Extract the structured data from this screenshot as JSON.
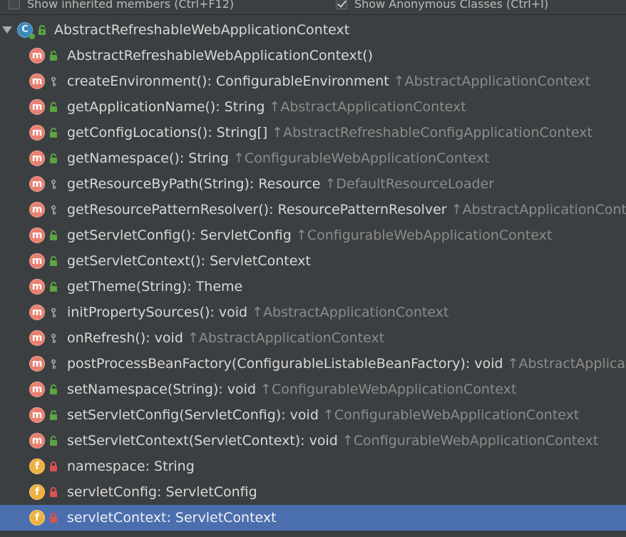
{
  "options": {
    "show_inherited_label": "Show inherited members (Ctrl+F12)",
    "show_inherited_checked": false,
    "show_anonymous_label": "Show Anonymous Classes (Ctrl+I)",
    "show_anonymous_checked": true
  },
  "root": {
    "name": "AbstractRefreshableWebApplicationContext",
    "icon": "abstract-class-icon",
    "visibility": "public",
    "expanded": true
  },
  "members": [
    {
      "kind": "m",
      "vis": "public",
      "name": "AbstractRefreshableWebApplicationContext()",
      "inherited": ""
    },
    {
      "kind": "m",
      "vis": "protected",
      "name": "createEnvironment(): ConfigurableEnvironment",
      "inherited": "↑AbstractApplicationContext"
    },
    {
      "kind": "m",
      "vis": "public",
      "name": "getApplicationName(): String",
      "inherited": "↑AbstractApplicationContext"
    },
    {
      "kind": "m",
      "vis": "public",
      "name": "getConfigLocations(): String[]",
      "inherited": "↑AbstractRefreshableConfigApplicationContext"
    },
    {
      "kind": "m",
      "vis": "public",
      "name": "getNamespace(): String",
      "inherited": "↑ConfigurableWebApplicationContext"
    },
    {
      "kind": "m",
      "vis": "protected",
      "name": "getResourceByPath(String): Resource",
      "inherited": "↑DefaultResourceLoader"
    },
    {
      "kind": "m",
      "vis": "protected",
      "name": "getResourcePatternResolver(): ResourcePatternResolver",
      "inherited": "↑AbstractApplicationConte"
    },
    {
      "kind": "m",
      "vis": "public",
      "name": "getServletConfig(): ServletConfig",
      "inherited": "↑ConfigurableWebApplicationContext"
    },
    {
      "kind": "m",
      "vis": "public",
      "name": "getServletContext(): ServletContext",
      "inherited": ""
    },
    {
      "kind": "m",
      "vis": "public",
      "name": "getTheme(String): Theme",
      "inherited": ""
    },
    {
      "kind": "m",
      "vis": "protected",
      "name": "initPropertySources(): void",
      "inherited": "↑AbstractApplicationContext"
    },
    {
      "kind": "m",
      "vis": "protected",
      "name": "onRefresh(): void",
      "inherited": "↑AbstractApplicationContext"
    },
    {
      "kind": "m",
      "vis": "protected",
      "name": "postProcessBeanFactory(ConfigurableListableBeanFactory): void",
      "inherited": "↑AbstractApplicat"
    },
    {
      "kind": "m",
      "vis": "public",
      "name": "setNamespace(String): void",
      "inherited": "↑ConfigurableWebApplicationContext"
    },
    {
      "kind": "m",
      "vis": "public",
      "name": "setServletConfig(ServletConfig): void",
      "inherited": "↑ConfigurableWebApplicationContext"
    },
    {
      "kind": "m",
      "vis": "public",
      "name": "setServletContext(ServletContext): void",
      "inherited": "↑ConfigurableWebApplicationContext"
    },
    {
      "kind": "f",
      "vis": "private",
      "name": "namespace: String",
      "inherited": ""
    },
    {
      "kind": "f",
      "vis": "private",
      "name": "servletConfig: ServletConfig",
      "inherited": ""
    },
    {
      "kind": "f",
      "vis": "private",
      "name": "servletContext: ServletContext",
      "inherited": "",
      "selected": true
    }
  ],
  "colors": {
    "background": "#3c3f41",
    "selection": "#4b6eaf",
    "method_badge": "#e8806f",
    "field_badge": "#f0b040",
    "public_lock": "#5aa642",
    "private_lock": "#d9534f",
    "protected_key": "#9a9a9a",
    "inherited_text": "#8c8c8c"
  }
}
